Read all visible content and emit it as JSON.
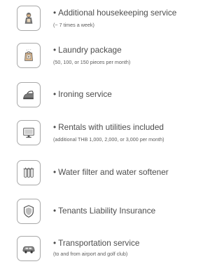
{
  "services": [
    {
      "icon": "maid-icon",
      "bullet": "•",
      "title": "Additional housekeeping service",
      "subtitle": "(~ 7 times a week)"
    },
    {
      "icon": "laundry-bag-icon",
      "bullet": "•",
      "title": "Laundry package",
      "subtitle": "(50, 100, or 150 pieces per month)"
    },
    {
      "icon": "iron-icon",
      "bullet": "•",
      "title": "Ironing service",
      "subtitle": ""
    },
    {
      "icon": "monitor-icon",
      "bullet": "•",
      "title": "Rentals with utilities included",
      "subtitle": "(additional THB 1,000, 2,000, or 3,000 per month)"
    },
    {
      "icon": "water-filter-icon",
      "bullet": "•",
      "title": "Water filter and water softener",
      "subtitle": ""
    },
    {
      "icon": "shield-icon",
      "bullet": "•",
      "title": "Tenants Liability Insurance",
      "subtitle": ""
    },
    {
      "icon": "car-icon",
      "bullet": "•",
      "title": "Transportation service",
      "subtitle": "(to and from airport and golf club)"
    }
  ]
}
